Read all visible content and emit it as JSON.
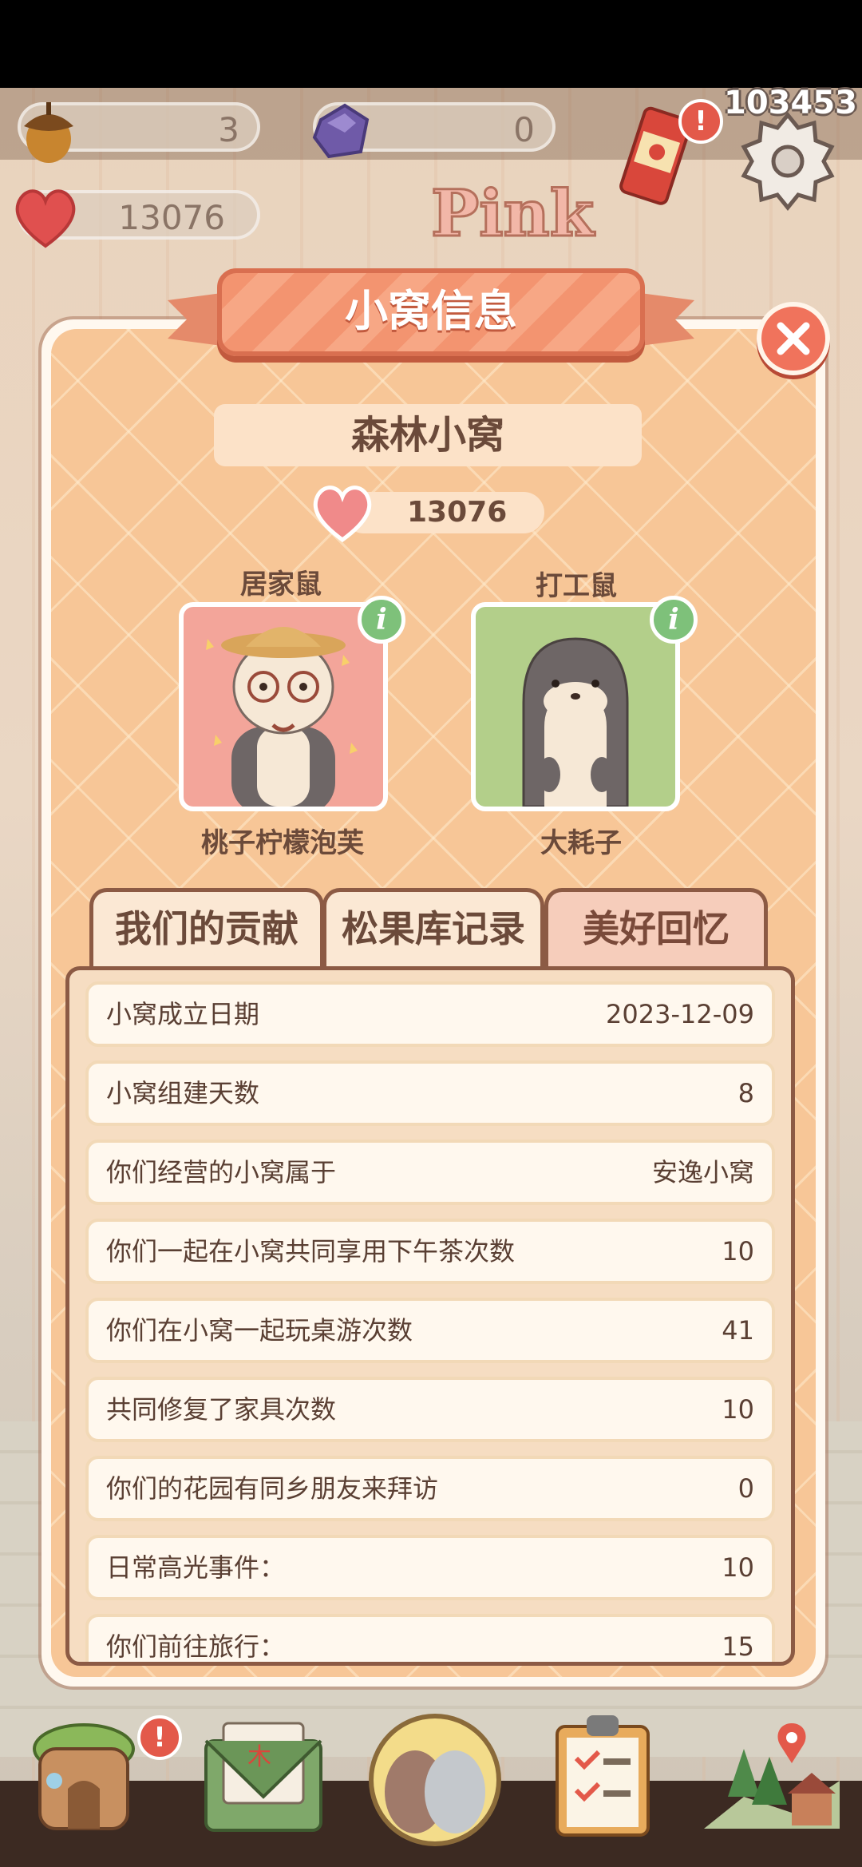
{
  "resources": {
    "acorn_value": "3",
    "gem_value": "0",
    "love_value": "13076",
    "score": "103453"
  },
  "decor": {
    "pink_sign": "Pink"
  },
  "dialog": {
    "title": "小窝信息",
    "nest_name": "森林小窝",
    "love_value": "13076"
  },
  "members": [
    {
      "role": "居家鼠",
      "name": "桃子柠檬泡芙"
    },
    {
      "role": "打工鼠",
      "name": "大耗子"
    }
  ],
  "tabs": [
    {
      "label": "我们的贡献"
    },
    {
      "label": "松果库记录"
    },
    {
      "label": "美好回忆"
    }
  ],
  "stats": [
    {
      "label": "小窝成立日期",
      "value": "2023-12-09"
    },
    {
      "label": "小窝组建天数",
      "value": "8"
    },
    {
      "label": "你们经营的小窝属于",
      "value": "安逸小窝"
    },
    {
      "label": "你们一起在小窝共同享用下午茶次数",
      "value": "10"
    },
    {
      "label": "你们在小窝一起玩桌游次数",
      "value": "41"
    },
    {
      "label": "共同修复了家具次数",
      "value": "10"
    },
    {
      "label": "你们的花园有同乡朋友来拜访",
      "value": "0"
    },
    {
      "label": "日常高光事件：",
      "value": "10"
    },
    {
      "label": "你们前往旅行：",
      "value": "15"
    }
  ],
  "bottom_nav": {
    "home_icon": "treehouse-icon",
    "mail_icon": "mail-icon",
    "characters_icon": "characters-icon",
    "tasks_icon": "clipboard-icon",
    "map_icon": "map-icon",
    "alert_mark": "!"
  },
  "colors": {
    "accent": "#f0735c",
    "panel": "#f7c697",
    "text": "#6b4a3a"
  }
}
